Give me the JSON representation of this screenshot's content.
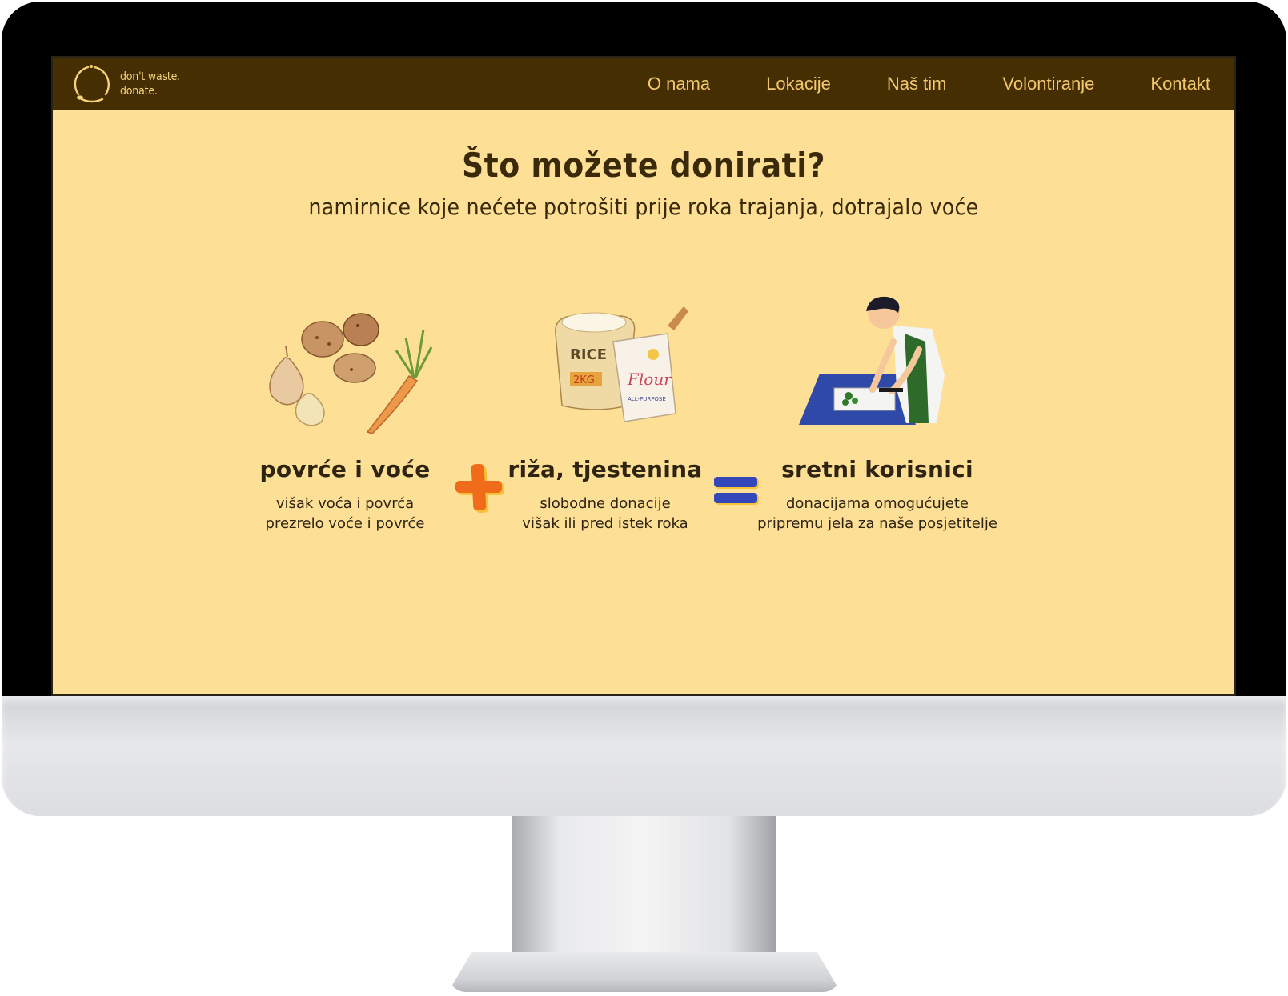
{
  "brand": {
    "line1": "don't waste.",
    "line2": "donate."
  },
  "nav": [
    "O nama",
    "Lokacije",
    "Naš tim",
    "Volontiranje",
    "Kontakt"
  ],
  "hero": {
    "title": "Što možete donirati?",
    "subtitle": "namirnice koje nećete potrošiti prije roka trajanja, dotrajalo voće"
  },
  "items": [
    {
      "title": "povrće i voće",
      "line1": "višak voća i povrća",
      "line2": "prezrelo voće i povrće"
    },
    {
      "title": "riža, tjestenina",
      "line1": "slobodne donacije",
      "line2": "višak ili pred istek roka"
    },
    {
      "title": "sretni korisnici",
      "line1": "donacijama omogućujete",
      "line2": "pripremu jela za naše posjetitelje"
    }
  ],
  "illustration_text": {
    "rice_label": "RICE",
    "rice_weight": "2KG",
    "flour_label": "Flour",
    "flour_sub": "ALL-PURPOSE"
  },
  "colors": {
    "navbar": "#452e02",
    "page_bg": "#fde096",
    "nav_text": "#f1c86f",
    "plus": "#f06b1a",
    "equals": "#3347b8"
  }
}
